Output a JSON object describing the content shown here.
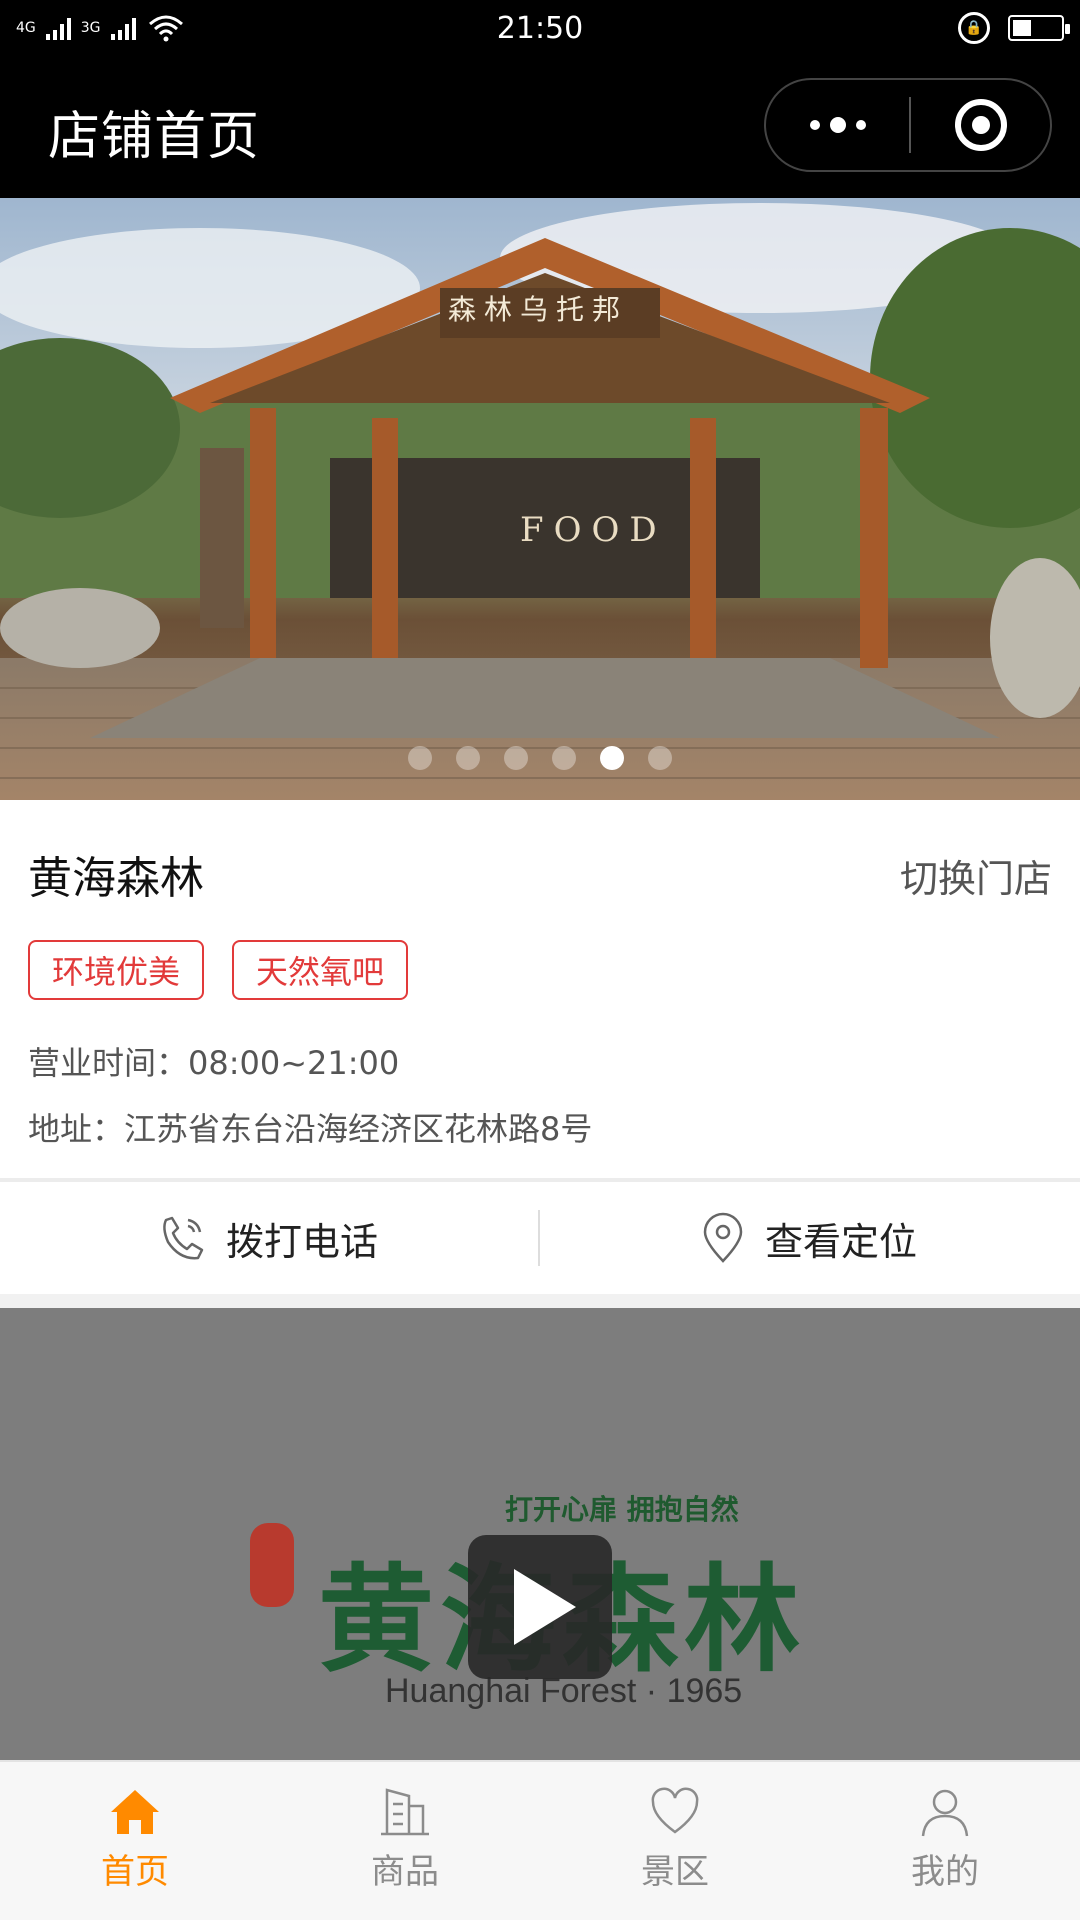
{
  "status_bar": {
    "time": "21:50",
    "network_1": "4G",
    "network_2": "3G"
  },
  "nav": {
    "title": "店铺首页",
    "more_icon": "more-dots-icon",
    "close_icon": "target-circle-icon"
  },
  "banner": {
    "sign_text": "森林乌托邦",
    "food_text": "FOOD",
    "slide_count": 6,
    "active_slide": 5
  },
  "store": {
    "name": "黄海森林",
    "switch_label": "切换门店",
    "tags": [
      "环境优美",
      "天然氧吧"
    ],
    "hours": "营业时间：08:00~21:00",
    "address": "地址：江苏省东台沿海经济区花林路8号"
  },
  "actions": {
    "call_label": "拨打电话",
    "location_label": "查看定位"
  },
  "video": {
    "slogan": "打开心扉  拥抱自然",
    "logo_text": "黄海森林",
    "subtitle": "Huanghai Forest · 1965"
  },
  "tabbar": {
    "items": [
      {
        "label": "首页",
        "icon": "home-icon",
        "active": true
      },
      {
        "label": "商品",
        "icon": "building-icon",
        "active": false
      },
      {
        "label": "景区",
        "icon": "heart-icon",
        "active": false
      },
      {
        "label": "我的",
        "icon": "user-icon",
        "active": false
      }
    ]
  },
  "colors": {
    "accent": "#ff8a00",
    "tag_red": "#e23a3a",
    "header_bg": "#000000"
  }
}
